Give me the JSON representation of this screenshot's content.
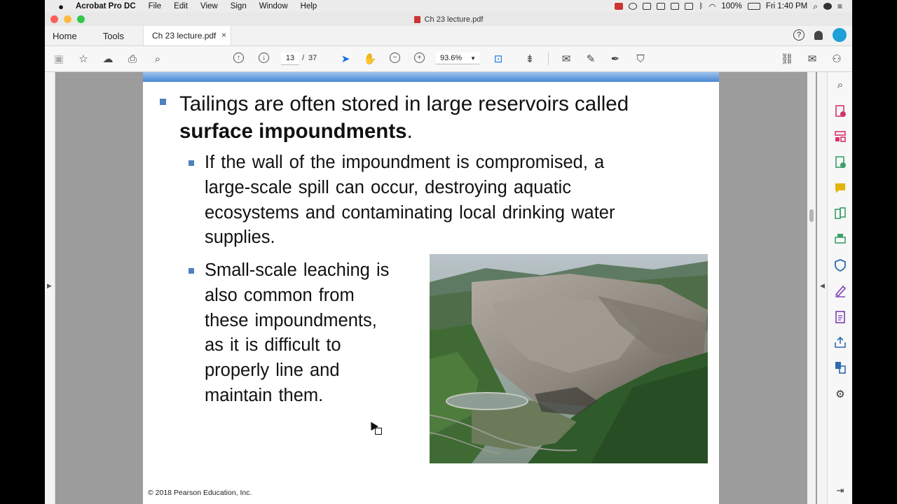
{
  "menubar": {
    "app_name": "Acrobat Pro DC",
    "items": [
      "File",
      "Edit",
      "View",
      "Sign",
      "Window",
      "Help"
    ],
    "battery": "100%",
    "clock": "Fri 1:40 PM"
  },
  "window": {
    "title": "Ch 23 lecture.pdf"
  },
  "tabbar": {
    "home_label": "Home",
    "tools_label": "Tools",
    "doc_tab_label": "Ch 23 lecture.pdf",
    "close_glyph": "×",
    "help_glyph": "?"
  },
  "toolbar": {
    "current_page": "13",
    "page_separator": "/",
    "total_pages": "37",
    "zoom": "93.6%"
  },
  "slide": {
    "bullet1_text": "Tailings are often stored in large reservoirs called",
    "bullet1_bold": "surface impoundments",
    "bullet1_end": ".",
    "sub1_lines": [
      "If the wall of the impoundment is compromised, a",
      "large-scale spill can occur, destroying aquatic",
      "ecosystems and contaminating local drinking water",
      "supplies."
    ],
    "sub2_lines": [
      "Small-scale leaching is",
      "also common from",
      "these impoundments,",
      "as it is difficult to",
      "properly line and",
      "maintain them."
    ],
    "copyright": "© 2018 Pearson Education, Inc."
  },
  "colors": {
    "bullet": "#4f81bd",
    "slide_band": "#4a87d3",
    "tool_pink": "#d6336c",
    "tool_yellow": "#e3b505",
    "tool_green": "#38a169",
    "tool_blue": "#2b6cb0",
    "tool_purple": "#7b3fb3"
  }
}
